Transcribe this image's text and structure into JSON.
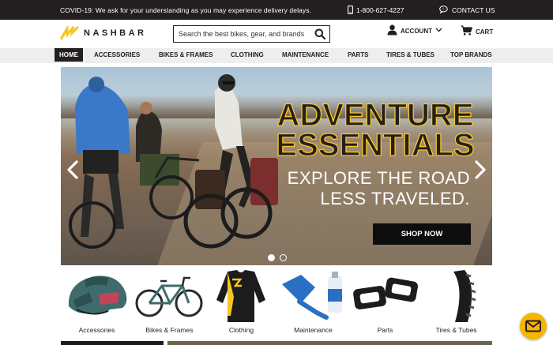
{
  "topbar": {
    "notice": "COVID-19: We ask for your understanding as you may experience delivery delays.",
    "phone": "1-800-627-4227",
    "contact": "CONTACT US",
    "bg": "#231f20"
  },
  "header": {
    "logo_text": "NASHBAR",
    "search_placeholder": "Search the best bikes, gear, and brands",
    "account": "ACCOUNT",
    "cart": "CART",
    "brand_color": "#f7c623"
  },
  "nav": {
    "items": [
      {
        "label": "HOME",
        "active": true
      },
      {
        "label": "ACCESSORIES"
      },
      {
        "label": "BIKES & FRAMES"
      },
      {
        "label": "CLOTHING"
      },
      {
        "label": "MAINTENANCE"
      },
      {
        "label": "PARTS"
      },
      {
        "label": "TIRES & TUBES"
      },
      {
        "label": "TOP BRANDS"
      }
    ]
  },
  "hero": {
    "headline_line1": "ADVENTURE",
    "headline_line2": "ESSENTIALS",
    "sub_line1": "EXPLORE THE ROAD",
    "sub_line2": "LESS TRAVELED.",
    "cta": "SHOP NOW",
    "slide_count": 2,
    "active_slide": 1
  },
  "categories": [
    {
      "label": "Accessories",
      "icon": "helmet-icon"
    },
    {
      "label": "Bikes & Frames",
      "icon": "bicycle-icon"
    },
    {
      "label": "Clothing",
      "icon": "jersey-icon"
    },
    {
      "label": "Maintenance",
      "icon": "chain-cleaner-icon"
    },
    {
      "label": "Parts",
      "icon": "pedals-icon"
    },
    {
      "label": "Tires & Tubes",
      "icon": "tire-icon"
    }
  ]
}
